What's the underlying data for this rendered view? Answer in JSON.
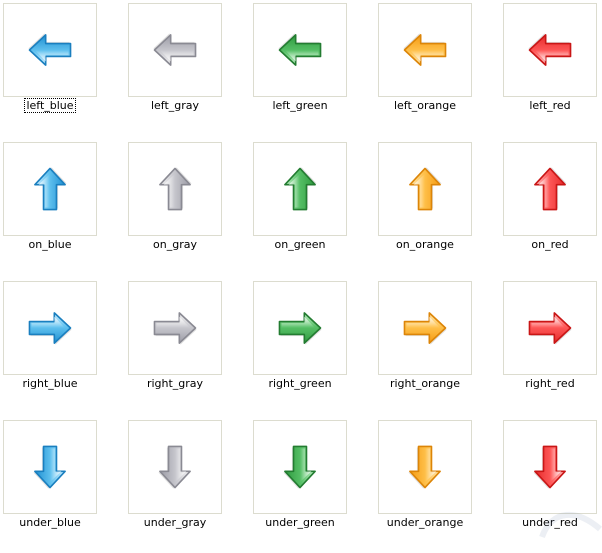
{
  "items": [
    {
      "label": "left_blue",
      "dir": "left",
      "color": "blue",
      "selected": true
    },
    {
      "label": "left_gray",
      "dir": "left",
      "color": "gray"
    },
    {
      "label": "left_green",
      "dir": "left",
      "color": "green"
    },
    {
      "label": "left_orange",
      "dir": "left",
      "color": "orange"
    },
    {
      "label": "left_red",
      "dir": "left",
      "color": "red"
    },
    {
      "label": "on_blue",
      "dir": "up",
      "color": "blue"
    },
    {
      "label": "on_gray",
      "dir": "up",
      "color": "gray"
    },
    {
      "label": "on_green",
      "dir": "up",
      "color": "green"
    },
    {
      "label": "on_orange",
      "dir": "up",
      "color": "orange"
    },
    {
      "label": "on_red",
      "dir": "up",
      "color": "red"
    },
    {
      "label": "right_blue",
      "dir": "right",
      "color": "blue"
    },
    {
      "label": "right_gray",
      "dir": "right",
      "color": "gray"
    },
    {
      "label": "right_green",
      "dir": "right",
      "color": "green"
    },
    {
      "label": "right_orange",
      "dir": "right",
      "color": "orange"
    },
    {
      "label": "right_red",
      "dir": "right",
      "color": "red"
    },
    {
      "label": "under_blue",
      "dir": "down",
      "color": "blue"
    },
    {
      "label": "under_gray",
      "dir": "down",
      "color": "gray"
    },
    {
      "label": "under_green",
      "dir": "down",
      "color": "green"
    },
    {
      "label": "under_orange",
      "dir": "down",
      "color": "orange"
    },
    {
      "label": "under_red",
      "dir": "down",
      "color": "red"
    }
  ],
  "colors": {
    "blue": {
      "light": "#cdeeff",
      "mid": "#63c3f0",
      "dark": "#1f8fd1",
      "stroke": "#1a7fbf"
    },
    "gray": {
      "light": "#f3f3f4",
      "mid": "#c9c9cf",
      "dark": "#9c9ca6",
      "stroke": "#8a8a93"
    },
    "green": {
      "light": "#bff0c4",
      "mid": "#58c168",
      "dark": "#2f9a3f",
      "stroke": "#237c31"
    },
    "orange": {
      "light": "#ffe7b0",
      "mid": "#ffc24d",
      "dark": "#f59b12",
      "stroke": "#dc8508"
    },
    "red": {
      "light": "#ffc4c4",
      "mid": "#ff5a5a",
      "dark": "#e52a2a",
      "stroke": "#c91616"
    }
  }
}
